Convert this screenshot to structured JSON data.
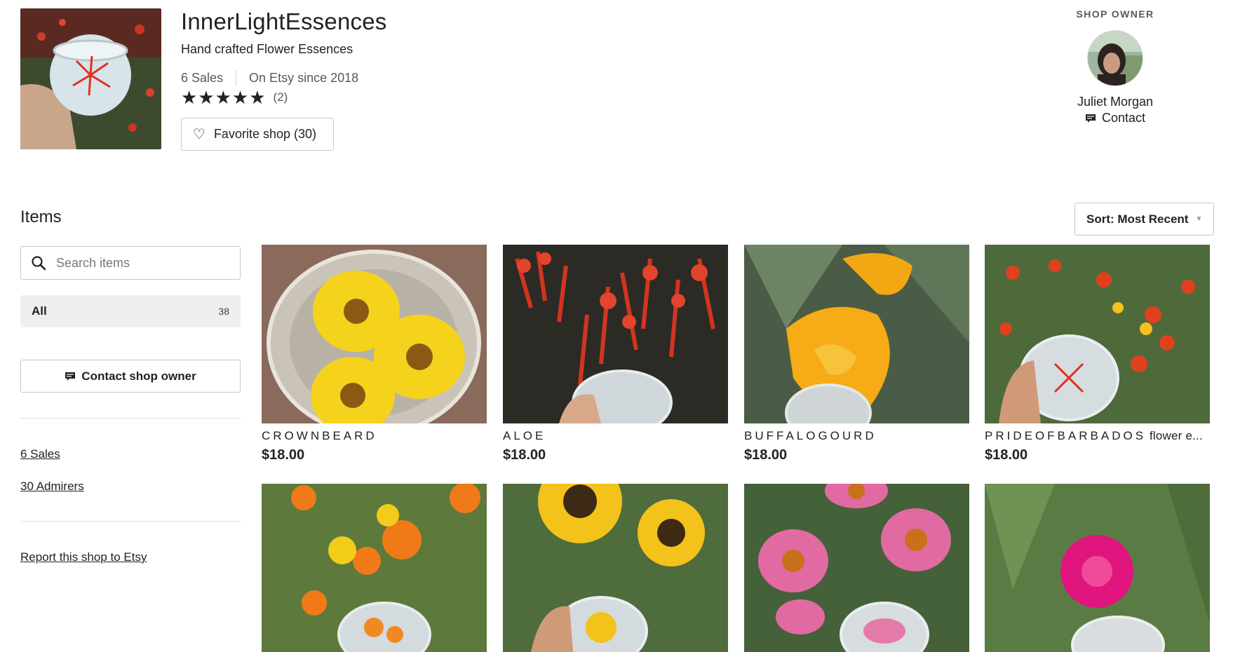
{
  "shop": {
    "name": "InnerLightEssences",
    "tagline": "Hand crafted Flower Essences",
    "sales": "6 Sales",
    "since": "On Etsy since 2018",
    "stars": "★★★★★",
    "review_count": "(2)",
    "favorite_label": "Favorite shop (30)"
  },
  "owner": {
    "heading": "SHOP OWNER",
    "name": "Juliet Morgan",
    "contact_label": "Contact"
  },
  "items": {
    "title": "Items",
    "sort_label": "Sort: Most Recent",
    "search_placeholder": "Search items",
    "category_all_label": "All",
    "category_all_count": "38"
  },
  "sidebar": {
    "contact_owner_label": "Contact shop owner",
    "sales_link": "6 Sales",
    "admirers_link": "30 Admirers",
    "report_link": "Report this shop to Etsy"
  },
  "listings": [
    {
      "title": "CROWNBEARD",
      "price": "$18.00"
    },
    {
      "title": "ALOE",
      "price": "$18.00"
    },
    {
      "title": "BUFFALOGOURD",
      "price": "$18.00"
    },
    {
      "title": "PRIDEOFBARBADOS",
      "title_rest": " flower e...",
      "price": "$18.00"
    }
  ],
  "colors": {
    "text": "#222222",
    "muted": "#595959",
    "border": "#c8c8c8",
    "category_bg": "#efefef"
  }
}
